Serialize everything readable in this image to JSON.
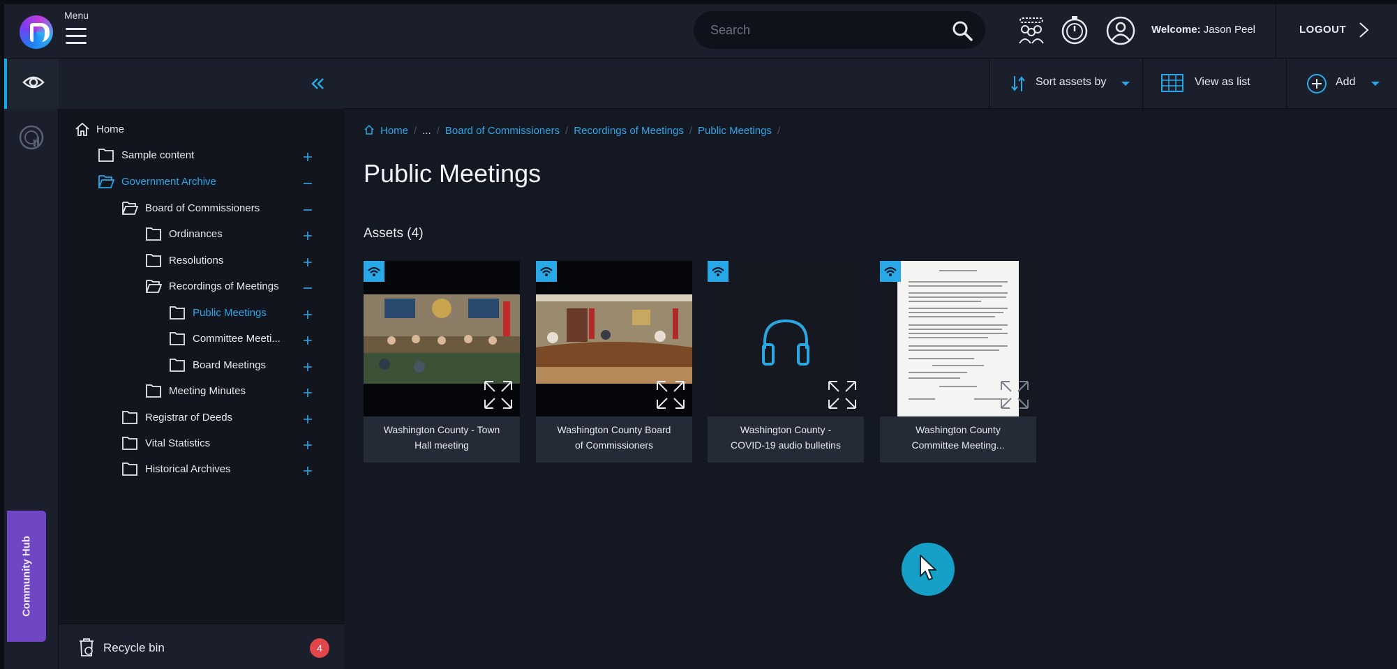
{
  "app": {
    "menu_label": "Menu",
    "search_placeholder": "Search",
    "welcome_prefix": "Welcome:",
    "user_name": "Jason Peel",
    "logout_label": "LOGOUT"
  },
  "rail": {
    "community_hub_label": "Community Hub"
  },
  "tree": {
    "items": [
      {
        "label": "Home"
      },
      {
        "label": "Sample content"
      },
      {
        "label": "Government Archive"
      },
      {
        "label": "Board of Commissioners"
      },
      {
        "label": "Ordinances"
      },
      {
        "label": "Resolutions"
      },
      {
        "label": "Recordings of Meetings"
      },
      {
        "label": "Public Meetings"
      },
      {
        "label": "Committee Meeti..."
      },
      {
        "label": "Board Meetings"
      },
      {
        "label": "Meeting Minutes"
      },
      {
        "label": "Registrar of Deeds"
      },
      {
        "label": "Vital Statistics"
      },
      {
        "label": "Historical Archives"
      }
    ],
    "recycle_bin_label": "Recycle bin",
    "recycle_bin_count": "4"
  },
  "toolbar": {
    "sort_label": "Sort assets by",
    "view_label": "View as list",
    "add_label": "Add"
  },
  "breadcrumb": [
    "Home",
    "...",
    "Board of Commissioners",
    "Recordings of Meetings",
    "Public Meetings"
  ],
  "page": {
    "title": "Public Meetings",
    "assets_label": "Assets (4)"
  },
  "assets": [
    {
      "caption_line1": "Washington County - Town",
      "caption_line2": "Hall meeting",
      "type": "video"
    },
    {
      "caption_line1": "Washington County Board",
      "caption_line2": "of Commissioners",
      "type": "video"
    },
    {
      "caption_line1": "Washington County -",
      "caption_line2": "COVID-19 audio bulletins",
      "type": "audio"
    },
    {
      "caption_line1": "Washington County",
      "caption_line2": "Committee Meeting...",
      "type": "document"
    }
  ],
  "colors": {
    "accent": "#29a8e8",
    "community_hub": "#6f47c4",
    "badge_red": "#e2454a"
  }
}
